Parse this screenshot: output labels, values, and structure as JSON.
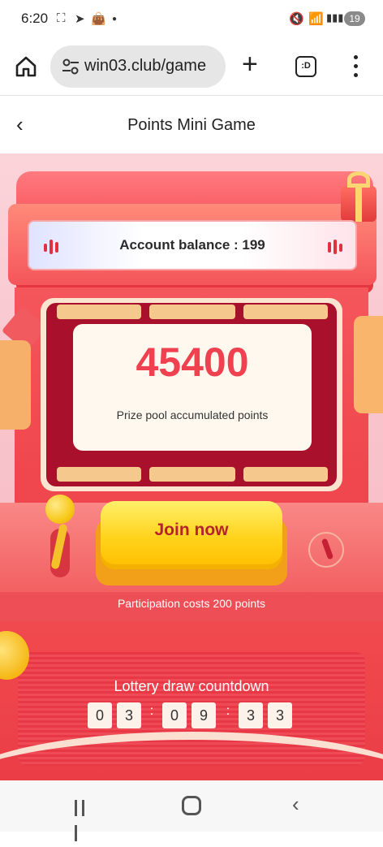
{
  "status_bar": {
    "time": "6:20",
    "battery": "19"
  },
  "browser": {
    "url": "win03.club/game",
    "tabs_label": ":D"
  },
  "header": {
    "title": "Points Mini Game"
  },
  "game": {
    "balance_text": "Account balance : 199",
    "prize_points": "45400",
    "prize_label": "Prize pool accumulated points",
    "join_label": "Join now",
    "cost_text": "Participation costs 200 points",
    "countdown_title": "Lottery draw countdown",
    "countdown_digits": [
      "0",
      "3",
      "0",
      "9",
      "3",
      "3"
    ]
  },
  "colors": {
    "accent_red": "#ef4150",
    "button_yellow": "#ffd21a",
    "button_text": "#b5222b"
  }
}
